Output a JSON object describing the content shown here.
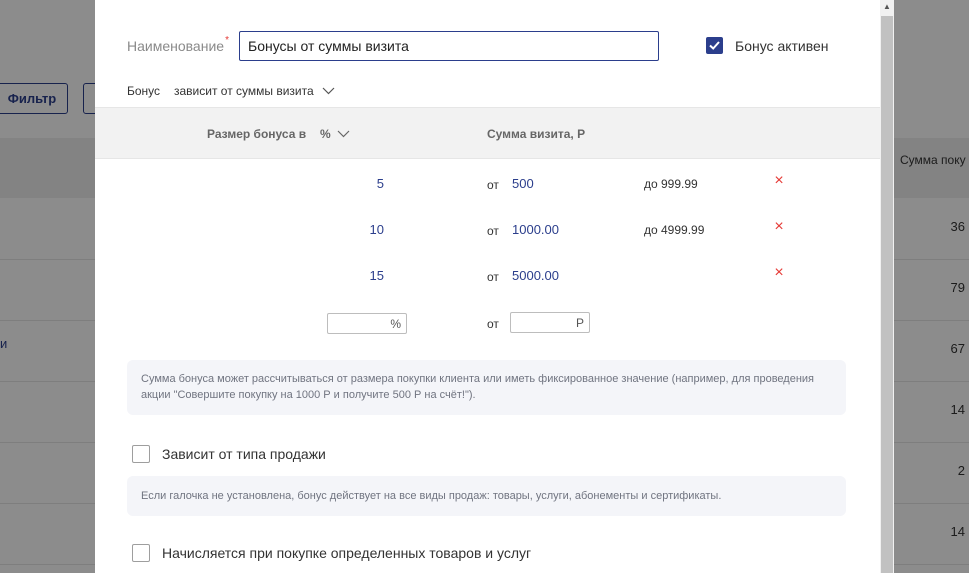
{
  "background": {
    "filter_button": "Фильтр",
    "column_header": "Сумма поку",
    "row_values": [
      "36",
      "79",
      "67",
      "14",
      "2",
      "14"
    ],
    "link_fragment": "и"
  },
  "modal": {
    "name_label": "Наименование",
    "required_mark": "*",
    "name_value": "Бонусы от суммы визита",
    "active_checked": true,
    "active_label": "Бонус активен",
    "bonus_label": "Бонус",
    "bonus_dependency": "зависит от суммы визита",
    "table": {
      "col_size": "Размер бонуса в",
      "col_unit": "%",
      "col_sum": "Сумма визита, Р",
      "rows": [
        {
          "pct": "5",
          "from_label": "от",
          "from": "500",
          "to": "до 999.99"
        },
        {
          "pct": "10",
          "from_label": "от",
          "from": "1000.00",
          "to": "до 4999.99"
        },
        {
          "pct": "15",
          "from_label": "от",
          "from": "5000.00",
          "to": ""
        }
      ],
      "new_row": {
        "pct_suffix": "%",
        "from_label": "от",
        "sum_suffix": "Р"
      }
    },
    "note1": "Сумма бонуса может рассчитываться от размера покупки клиента или иметь фиксированное значение (например, для проведения акции \"Совершите покупку на 1000 Р и получите 500 Р на счёт!\").",
    "depends_sale_type_label": "Зависит от типа продажи",
    "note2": "Если галочка не установлена, бонус действует на все виды продаж: товары, услуги, абонементы и сертификаты.",
    "specific_goods_label": "Начисляется при покупке определенных товаров и услуг",
    "delete_symbol": "×"
  },
  "colors": {
    "accent": "#2b3e8c",
    "danger": "#e53935"
  }
}
